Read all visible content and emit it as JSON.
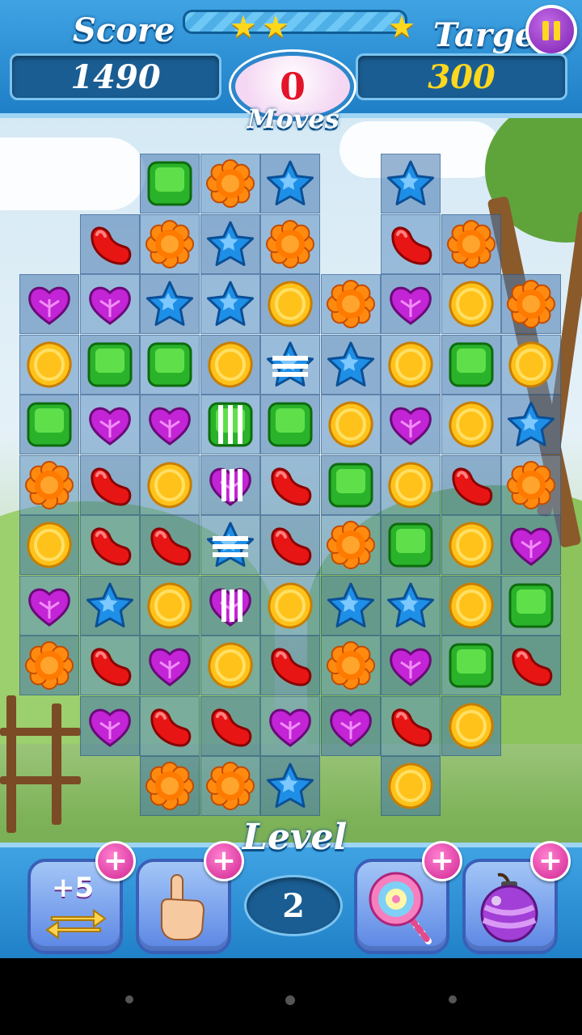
{
  "hud": {
    "score_label": "Score",
    "score_value": "1490",
    "target_label": "Target",
    "target_value": "300",
    "moves_value": "0",
    "moves_label": "Moves",
    "stars_earned": 3
  },
  "level": {
    "label": "Level",
    "value": "2"
  },
  "boosters": [
    {
      "name": "extra-moves",
      "label": "+5",
      "icon": "swap-arrows-icon"
    },
    {
      "name": "hand",
      "icon": "pointing-hand-icon"
    },
    {
      "name": "lollipop",
      "icon": "lollipop-icon"
    },
    {
      "name": "bomb",
      "icon": "bomb-icon"
    }
  ],
  "board": {
    "columns": 9,
    "rows": 11,
    "layout": [
      "..GOB.B..",
      ".ROBO.RO.",
      "PPBBYOPYO",
      "YGGYsBYGY",
      "GPPgGYPYB",
      "ORYpRGYRO",
      "YRRsROGYP",
      "PBYpYBBYG",
      "ORPYROPGR",
      ".PRRPPRY.",
      "..OOB.Y.."
    ],
    "legend": {
      "G": "green-square",
      "Y": "yellow-oval",
      "B": "blue-star",
      "R": "red-jellybean",
      "O": "orange-flower",
      "P": "purple-heart",
      "s": "striped-blue-star",
      "g": "striped-green-square",
      "p": "striped-purple-heart"
    }
  },
  "colors": {
    "bar_blue": "#2a8fd6",
    "moves_red": "#e3142a",
    "target_yellow": "#ffd71e",
    "score_white": "#ffffff"
  }
}
